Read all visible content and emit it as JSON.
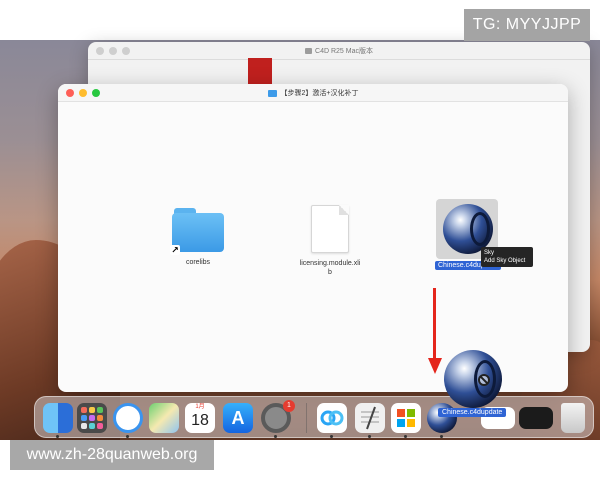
{
  "watermark": {
    "top": "TG: MYYJJPP",
    "bottom": "www.zh-28quanweb.org"
  },
  "back_window": {
    "title": "C4D R25 Mac版本"
  },
  "front_window": {
    "title": "【步骤2】激活+汉化补丁",
    "items": [
      {
        "label": "corelibs",
        "icon": "folder-alias-icon"
      },
      {
        "label": "licensing.module.xlib",
        "icon": "document-icon"
      },
      {
        "label": "Chinese.c4dupdate",
        "icon": "cinema4d-icon",
        "selected": true
      }
    ]
  },
  "tooltip": {
    "line1": "Sky",
    "line2": "Add Sky Object"
  },
  "drag": {
    "label": "Chinese.c4dupdate",
    "icon": "cinema4d-icon"
  },
  "dock": {
    "calendar_month": "1月",
    "calendar_day": "18",
    "settings_badge": "1",
    "apps": [
      "finder-icon",
      "launchpad-icon",
      "safari-icon",
      "maps-icon",
      "calendar-icon",
      "app-store-icon",
      "system-settings-icon",
      "baidu-netdisk-icon",
      "textedit-icon",
      "office-icon",
      "cinema4d-icon",
      "screenshot-icon",
      "terminal-icon",
      "trash-icon"
    ]
  },
  "colors": {
    "selection": "#2f64d4",
    "arrow": "#e4251b",
    "close": "#fe5f57",
    "minimize": "#febc2e",
    "zoom": "#28c840"
  }
}
